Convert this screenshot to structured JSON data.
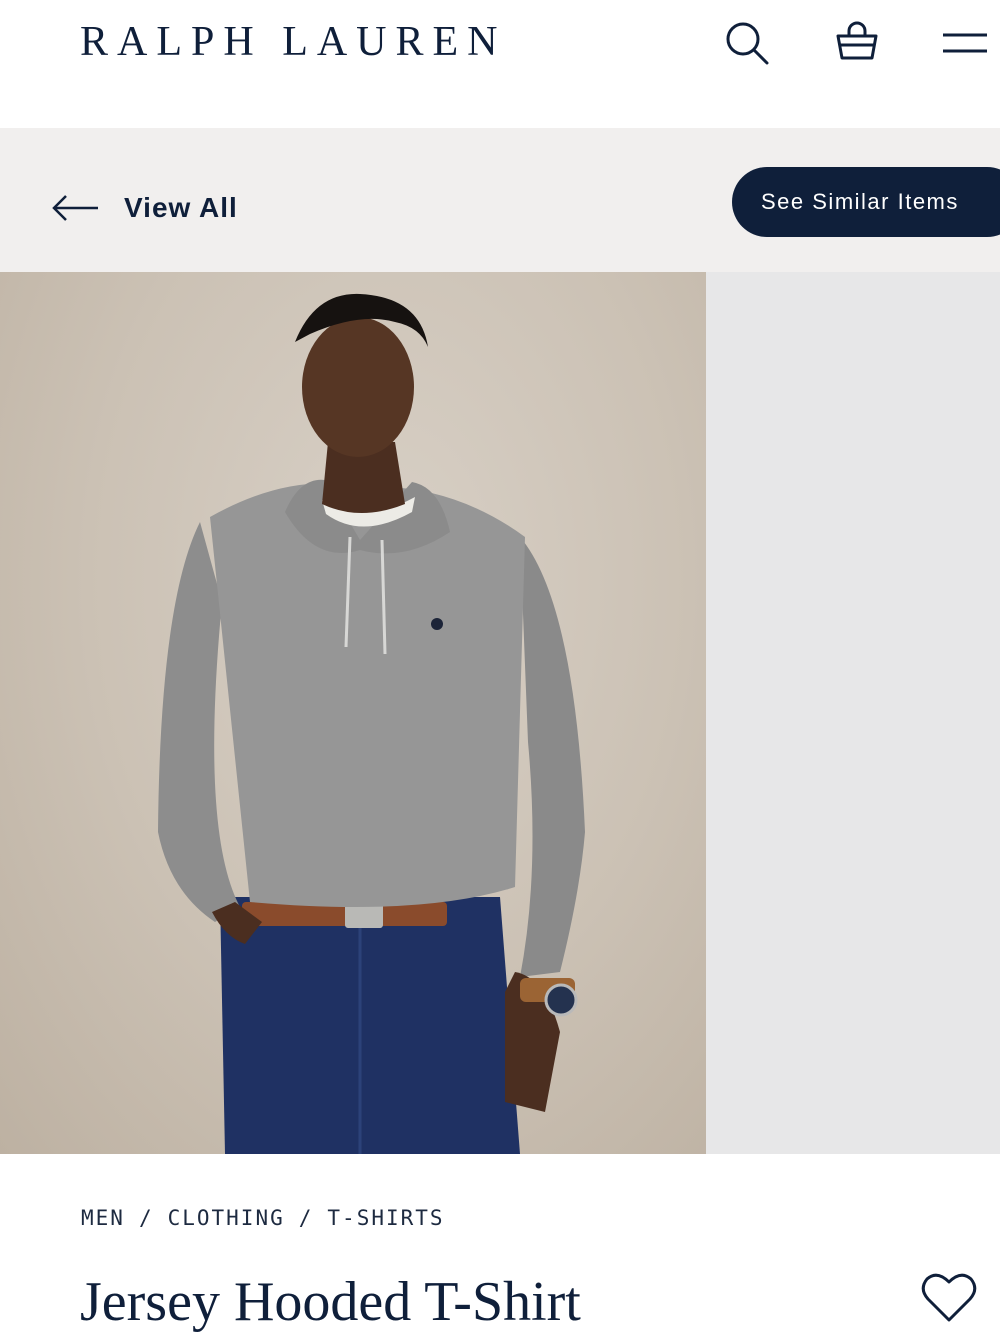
{
  "header": {
    "brand": "RALPH LAUREN",
    "icons": [
      "search-icon",
      "shopping-bag-icon",
      "menu-icon"
    ]
  },
  "nav": {
    "back_label": "View All",
    "similar_label": "See Similar Items"
  },
  "breadcrumb": {
    "items": [
      "MEN",
      "CLOTHING",
      "T-SHIRTS"
    ],
    "separator": "/"
  },
  "product": {
    "title": "Jersey Hooded T-Shirt"
  },
  "colors": {
    "navy": "#0f1f3a",
    "band": "#f1efee",
    "side": "#e7e7e8"
  }
}
